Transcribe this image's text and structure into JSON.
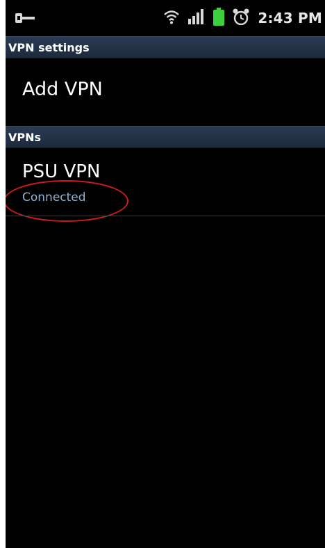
{
  "status_bar": {
    "time": "2:43 PM",
    "icons": [
      "key-icon",
      "wifi-icon",
      "signal-icon",
      "battery-icon",
      "alarm-icon"
    ],
    "battery_color": "#3ccf3c"
  },
  "screen": {
    "title": "VPN settings",
    "add_vpn_label": "Add VPN",
    "vpns_header": "VPNs",
    "vpns": [
      {
        "name": "PSU VPN",
        "status": "Connected"
      }
    ]
  },
  "colors": {
    "header_bg": "#22324a",
    "status_text": "#8fb3cf",
    "annotation": "#d11a1a"
  }
}
